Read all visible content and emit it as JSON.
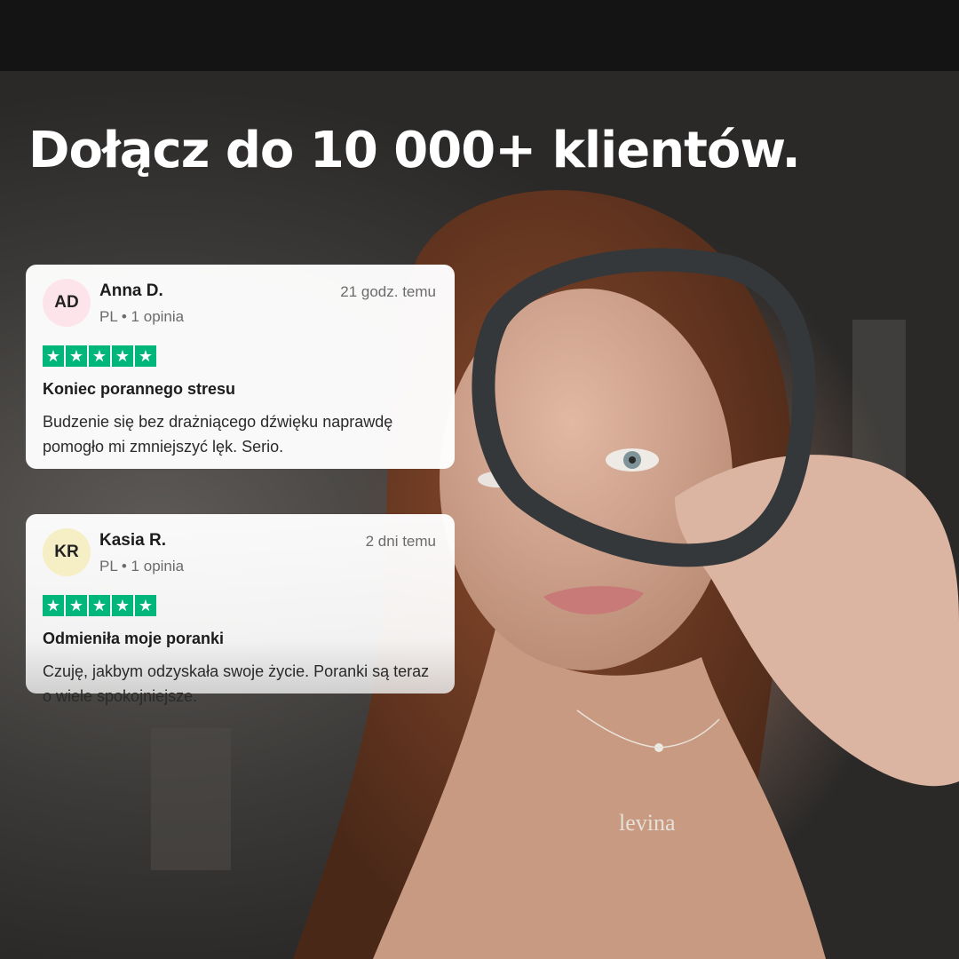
{
  "headline": "Dołącz do 10 000+ klientów.",
  "colors": {
    "star_green": "#00b67a",
    "avatar_pink": "#fde4ea",
    "avatar_yellow": "#f6eec4"
  },
  "reviews": [
    {
      "initials": "AD",
      "name": "Anna D.",
      "meta": "PL • 1 opinia",
      "time": "21 godz. temu",
      "rating": 5,
      "title": "Koniec porannego stresu",
      "body": "Budzenie się bez drażniącego dźwięku naprawdę pomogło mi zmniejszyć lęk. Serio."
    },
    {
      "initials": "KR",
      "name": "Kasia R.",
      "meta": "PL • 1 opinia",
      "time": "2 dni temu",
      "rating": 5,
      "title": "Odmieniła moje poranki",
      "body": "Czuję, jakbym odzyskała swoje życie. Poranki są teraz o wiele spokojniejsze."
    }
  ],
  "photo": {
    "description_icon": "woman-holding-wristband-photo",
    "necklace_text": "levina"
  }
}
